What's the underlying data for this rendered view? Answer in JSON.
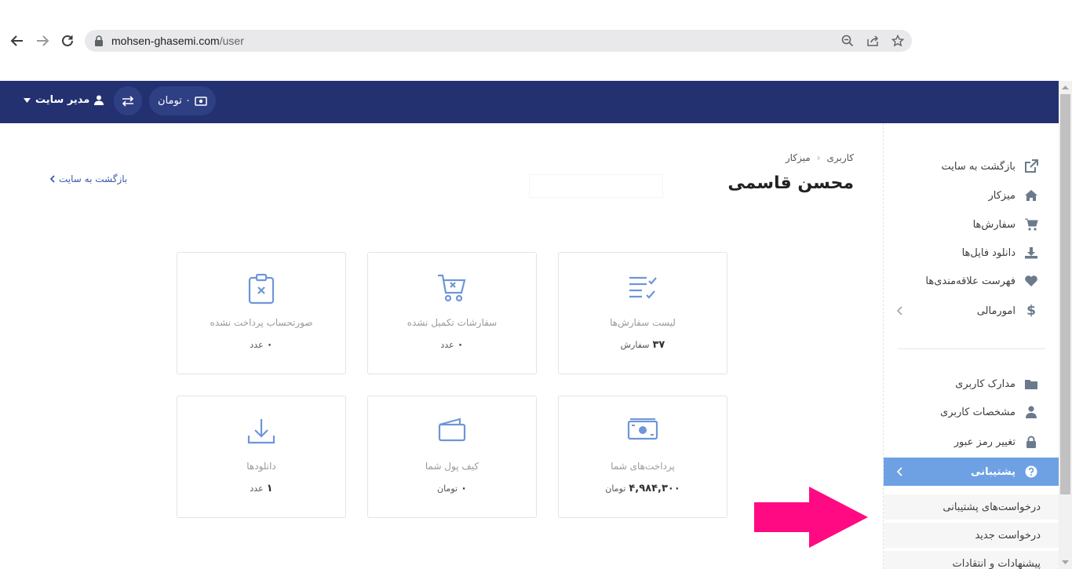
{
  "browser": {
    "url_host": "mohsen-ghasemi.com",
    "url_path": "/user"
  },
  "appbar": {
    "balance": "۰ تومان",
    "admin_label": "مدیر سایت"
  },
  "header": {
    "breadcrumb": [
      "کاربری",
      "میزکار"
    ],
    "title": "محسن قاسمی",
    "back_link": "بازگشت به سایت"
  },
  "cards": [
    {
      "label": "لیست سفارش‌ها",
      "value": "۳۷",
      "unit": "سفارش",
      "icon": "list-check-icon"
    },
    {
      "label": "سفارشات تکمیل نشده",
      "value": "۰",
      "unit": "عدد",
      "icon": "cart-x-icon"
    },
    {
      "label": "صورتحساب پرداخت نشده",
      "value": "۰",
      "unit": "عدد",
      "icon": "clipboard-x-icon"
    },
    {
      "label": "پرداخت‌های شما",
      "value": "۴,۹۸۴,۳۰۰",
      "unit": "تومان",
      "icon": "banknote-icon"
    },
    {
      "label": "کیف پول شما",
      "value": "۰",
      "unit": "تومان",
      "icon": "wallet-icon"
    },
    {
      "label": "دانلودها",
      "value": "۱",
      "unit": "عدد",
      "icon": "download-icon"
    }
  ],
  "sidebar": {
    "items": [
      {
        "label": "بازگشت به سایت",
        "icon": "external-link-icon"
      },
      {
        "label": "میزکار",
        "icon": "home-icon"
      },
      {
        "label": "سفارش‌ها",
        "icon": "cart-icon"
      },
      {
        "label": "دانلود فایل‌ها",
        "icon": "download-icon"
      },
      {
        "label": "فهرست علاقه‌مندی‌ها",
        "icon": "heart-icon"
      },
      {
        "label": "امورمالی",
        "icon": "dollar-icon"
      },
      {
        "label": "مدارک کاربری",
        "icon": "folder-icon"
      },
      {
        "label": "مشخصات کاربری",
        "icon": "user-icon"
      },
      {
        "label": "تغییر رمز عبور",
        "icon": "lock-icon"
      },
      {
        "label": "پشتیبانی",
        "icon": "question-circle-icon"
      }
    ],
    "support_sub": [
      "درخواست‌های پشتیبانی",
      "درخواست جدید",
      "پیشنهادات و انتقادات"
    ]
  },
  "colors": {
    "appbar": "#233170",
    "accent": "#6ea0e4",
    "annotation_arrow": "#ff0a82"
  }
}
